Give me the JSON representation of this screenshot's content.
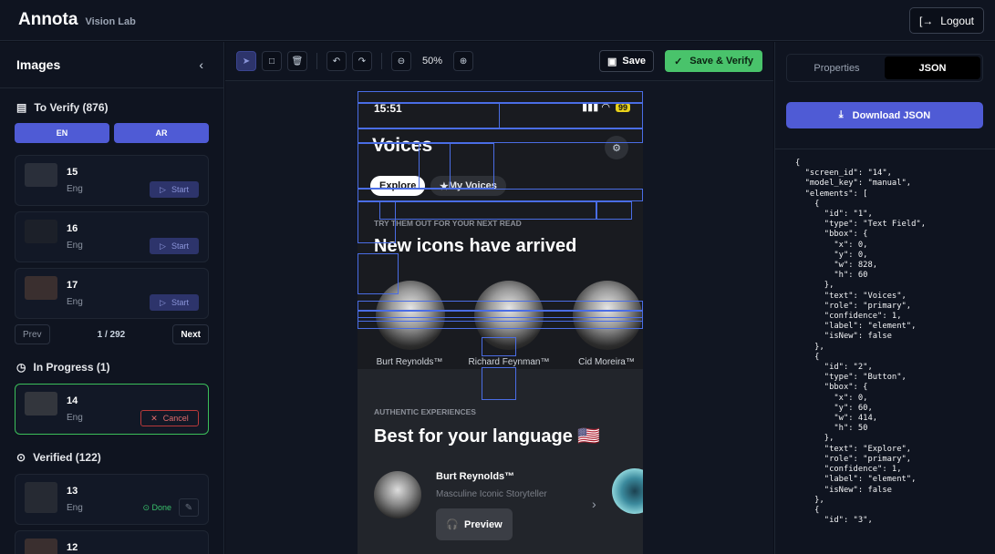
{
  "app": {
    "name": "Annota",
    "subtitle": "Vision Lab",
    "logout": "Logout"
  },
  "sidebar": {
    "title": "Images",
    "to_verify": {
      "label": "To Verify (876)",
      "langs": [
        "EN",
        "AR"
      ],
      "items": [
        {
          "num": "15",
          "lang": "Eng",
          "action": "Start"
        },
        {
          "num": "16",
          "lang": "Eng",
          "action": "Start"
        },
        {
          "num": "17",
          "lang": "Eng",
          "action": "Start"
        }
      ]
    },
    "pager": {
      "prev": "Prev",
      "info": "1 / 292",
      "next": "Next"
    },
    "in_progress": {
      "label": "In Progress (1)",
      "item": {
        "num": "14",
        "lang": "Eng",
        "action": "Cancel"
      }
    },
    "verified": {
      "label": "Verified (122)",
      "items": [
        {
          "num": "13",
          "lang": "Eng",
          "status": "Done"
        },
        {
          "num": "12"
        }
      ]
    }
  },
  "toolbar": {
    "zoom": "50%",
    "save": "Save",
    "verify": "Save & Verify"
  },
  "phone": {
    "time": "15:51",
    "battery": "99",
    "title": "Voices",
    "chips": [
      "Explore",
      "My Voices"
    ],
    "kicker": "TRY THEM OUT FOR YOUR NEXT READ",
    "headline": "New icons have arrived",
    "voices": [
      "Burt Reynolds™",
      "Richard Feynman™",
      "Cid Moreira™"
    ],
    "kicker2": "AUTHENTIC EXPERIENCES",
    "headline2": "Best for your language 🇺🇸",
    "featured": {
      "name": "Burt Reynolds™",
      "desc": "Masculine Iconic Storyteller",
      "preview": "Preview"
    }
  },
  "rpanel": {
    "tabs": [
      "Properties",
      "JSON"
    ],
    "download": "Download JSON"
  },
  "json_text": "{\n  \"screen_id\": \"14\",\n  \"model_key\": \"manual\",\n  \"elements\": [\n    {\n      \"id\": \"1\",\n      \"type\": \"Text Field\",\n      \"bbox\": {\n        \"x\": 0,\n        \"y\": 0,\n        \"w\": 828,\n        \"h\": 60\n      },\n      \"text\": \"Voices\",\n      \"role\": \"primary\",\n      \"confidence\": 1,\n      \"label\": \"element\",\n      \"isNew\": false\n    },\n    {\n      \"id\": \"2\",\n      \"type\": \"Button\",\n      \"bbox\": {\n        \"x\": 0,\n        \"y\": 60,\n        \"w\": 414,\n        \"h\": 50\n      },\n      \"text\": \"Explore\",\n      \"role\": \"primary\",\n      \"confidence\": 1,\n      \"label\": \"element\",\n      \"isNew\": false\n    },\n    {\n      \"id\": \"3\","
}
